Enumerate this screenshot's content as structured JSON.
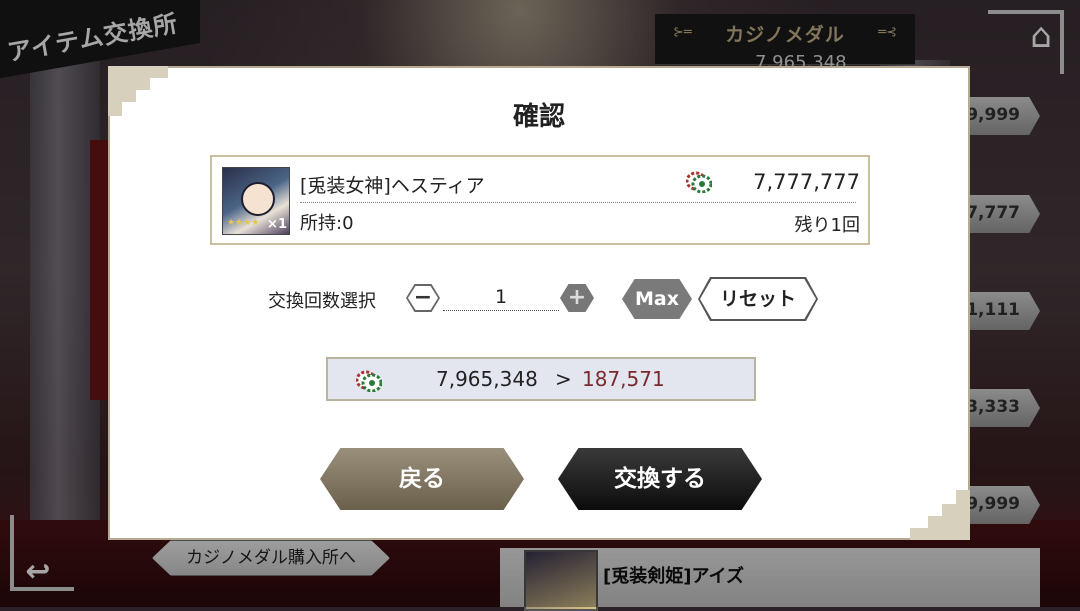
{
  "background": {
    "screen_title": "アイテム交換所",
    "medal_header": {
      "label": "カジノメダル",
      "amount": "7,965,348"
    },
    "side_prices": [
      "9,999",
      "7,777",
      "1,111",
      "3,333",
      "9,999"
    ],
    "purchase_link_label": "カジノメダル購入所へ",
    "bottom_card_label": "[兎装剣姫]アイズ",
    "home_icon": "home-icon",
    "back_icon": "return-arrow-icon"
  },
  "dialog": {
    "title": "確認",
    "item": {
      "name": "[兎装女神]ヘスティア",
      "cost": "7,777,777",
      "owned": "所持:0",
      "remaining": "残り1回",
      "stars": "★★★★",
      "quantity_badge": "×1",
      "currency_icon": "casino-chip-icon"
    },
    "quantity": {
      "label": "交換回数選択",
      "minus": "−",
      "value": "1",
      "plus": "+",
      "max_label": "Max",
      "reset_label": "リセット"
    },
    "balance": {
      "current": "7,965,348",
      "arrow": ">",
      "after": "187,571"
    },
    "buttons": {
      "back": "戻る",
      "exchange": "交換する"
    }
  },
  "colors": {
    "accent_gold": "#c8b58a",
    "balance_after": "#7a2a2e",
    "back_button": "#7d725c",
    "exchange_button": "#111111"
  }
}
